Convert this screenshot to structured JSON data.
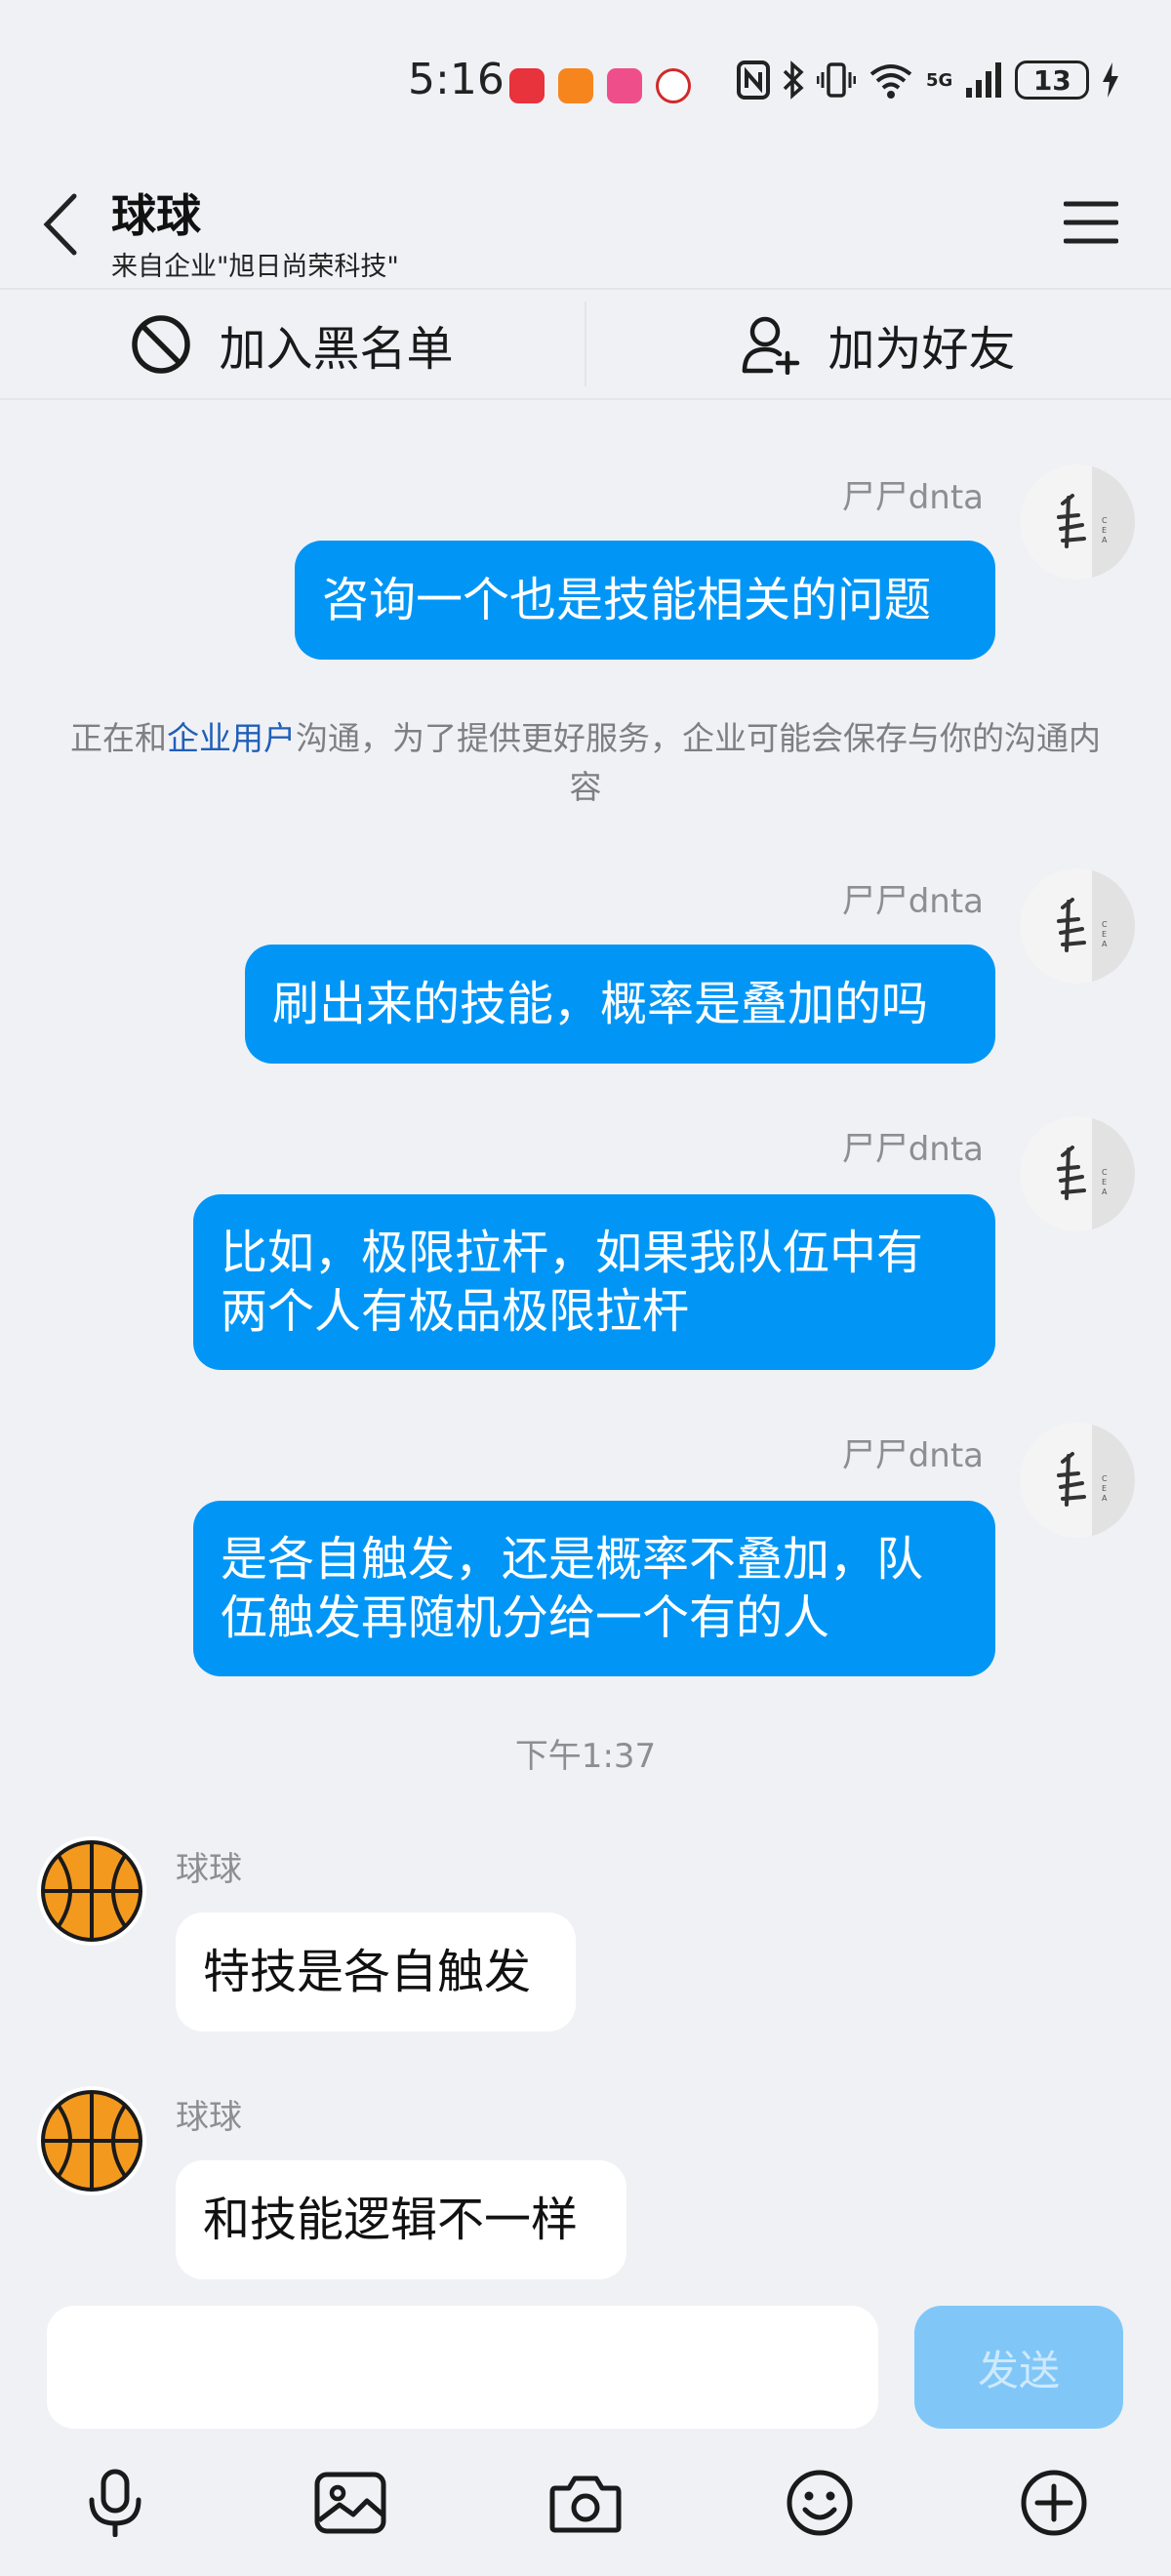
{
  "status_bar": {
    "time": "5:16",
    "network": "5G",
    "battery": "13"
  },
  "header": {
    "title": "球球",
    "subtitle": "来自企业\"旭日尚荣科技\""
  },
  "actions": {
    "block_label": "加入黑名单",
    "add_friend_label": "加为好友"
  },
  "messages": [
    {
      "sender": "尸尸dnta",
      "direction": "out",
      "text": "咨询一个也是技能相关的问题"
    },
    {
      "sender": "尸尸dnta",
      "direction": "out",
      "text": "刷出来的技能，概率是叠加的吗"
    },
    {
      "sender": "尸尸dnta",
      "direction": "out",
      "text": "比如，极限拉杆，如果我队伍中有两个人有极品极限拉杆"
    },
    {
      "sender": "尸尸dnta",
      "direction": "out",
      "text": "是各自触发，还是概率不叠加，队伍触发再随机分给一个有的人"
    },
    {
      "sender": "球球",
      "direction": "in",
      "text": "特技是各自触发"
    },
    {
      "sender": "球球",
      "direction": "in",
      "text": "和技能逻辑不一样"
    }
  ],
  "notice": {
    "prefix": "正在和",
    "link": "企业用户",
    "suffix": "沟通，为了提供更好服务，企业可能会保存与你的沟通内容"
  },
  "time_divider": "下午1:37",
  "input": {
    "value": "",
    "send_label": "发送"
  },
  "toolbar": {
    "icons": [
      "microphone-icon",
      "image-icon",
      "camera-icon",
      "emoji-icon",
      "plus-icon"
    ]
  },
  "colors": {
    "outgoing_bubble": "#0196f6",
    "incoming_bubble": "#ffffff",
    "background": "#f0f1f5",
    "send_button_disabled": "#80c7f8",
    "notice_link": "#1f5fb8"
  }
}
